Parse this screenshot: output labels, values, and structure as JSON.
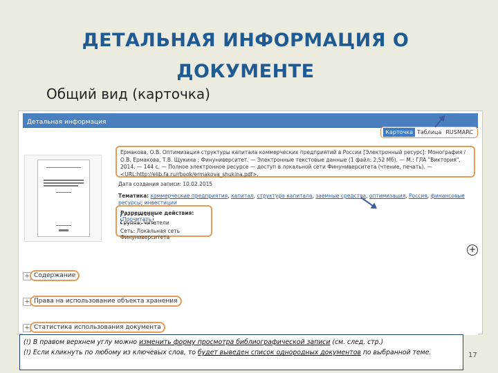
{
  "slide": {
    "title": "ДЕТАЛЬНАЯ  ИНФОРМАЦИЯ  О ДОКУМЕНТЕ",
    "subtitle": "Общий вид (карточка)",
    "page_number": "17"
  },
  "panel": {
    "header": "Детальная информация",
    "tabs": [
      "Карточка",
      "Таблица",
      "RUSMARC"
    ],
    "bib_record": "Ермакова, О.В. Оптимизация структуры капитала коммерческих предприятий в России [Электронный ресурс]: Монография / О.В. Ермакова, Т.В. Щукина ; Финуниверситет. — Электронные текстовые данные (1 файл: 2,52 Мб). — М.: ГЛА \"Виктория\", 2014. — 144 с. — Полное электронное ресурсе — доступ в локальной сети Финуниверситета (чтение, печать). — <URL:http://elib.fa.ru/rbook/ermakova_shukina.pdf>.",
    "date_label": "Дата создания записи: 10.02.2015",
    "themes_label": "Тематика:",
    "themes_links": [
      "коммерческие предприятия",
      "капитал",
      "структура капитала",
      "заемные средства",
      "оптимизация",
      "Россия",
      "финансовые ресурсы",
      "инвестиции"
    ],
    "rights_label": "Разрешенные действия:",
    "rights_action": "Прочитать",
    "group_label": "Группа: Читатели",
    "network_label": "Сеть: Локальная сеть Финуниверситета",
    "sections": [
      "Содержание",
      "Права на использование объекта хранения",
      "Статистика использования документа"
    ]
  },
  "cover": {
    "author": "Ермакова О.В., Щукина Т.В.",
    "title": "Оптимизация структуры капитала коммерческих предприятий в России",
    "type": "Монография"
  },
  "note": {
    "line1_prefix": "(!)  В правом верхнем углу можно ",
    "line1_link": "изменить форму просмотра библиографической записи",
    "line1_suffix": " (см. след. стр.)",
    "line2_prefix": "(!) Если кликнуть по любому из ключевых слов, то ",
    "line2_link": "будет выведен список однородных документов",
    "line2_suffix": " по выбранной теме."
  },
  "colors": {
    "title": "#1f5a92",
    "header": "#4a7fc0",
    "highlight": "#e59a55",
    "arrow": "#3b5d9a"
  }
}
